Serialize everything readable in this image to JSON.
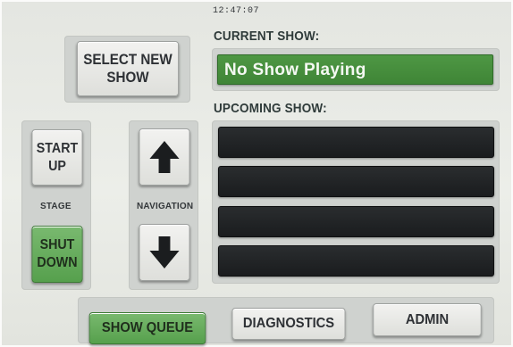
{
  "clock": "12:47:07",
  "select_show": {
    "line1": "SELECT NEW",
    "line2": "SHOW"
  },
  "current_show": {
    "heading": "CURRENT SHOW:",
    "value": "No Show Playing"
  },
  "upcoming_show": {
    "heading": "UPCOMING SHOW:",
    "slots": [
      "",
      "",
      "",
      ""
    ]
  },
  "stage": {
    "label": "STAGE",
    "start_up": {
      "line1": "START",
      "line2": "UP"
    },
    "shut_down": {
      "line1": "SHUT",
      "line2": "DOWN"
    }
  },
  "navigation": {
    "label": "NAVIGATION",
    "up_icon": "arrow-up-icon",
    "down_icon": "arrow-down-icon"
  },
  "bottom_nav": {
    "show_queue": "SHOW QUEUE",
    "diagnostics": "DIAGNOSTICS",
    "admin": "ADMIN"
  },
  "colors": {
    "accent_green": "#4e9744",
    "slot_black": "#1f2123",
    "panel": "#cfd2cf"
  }
}
